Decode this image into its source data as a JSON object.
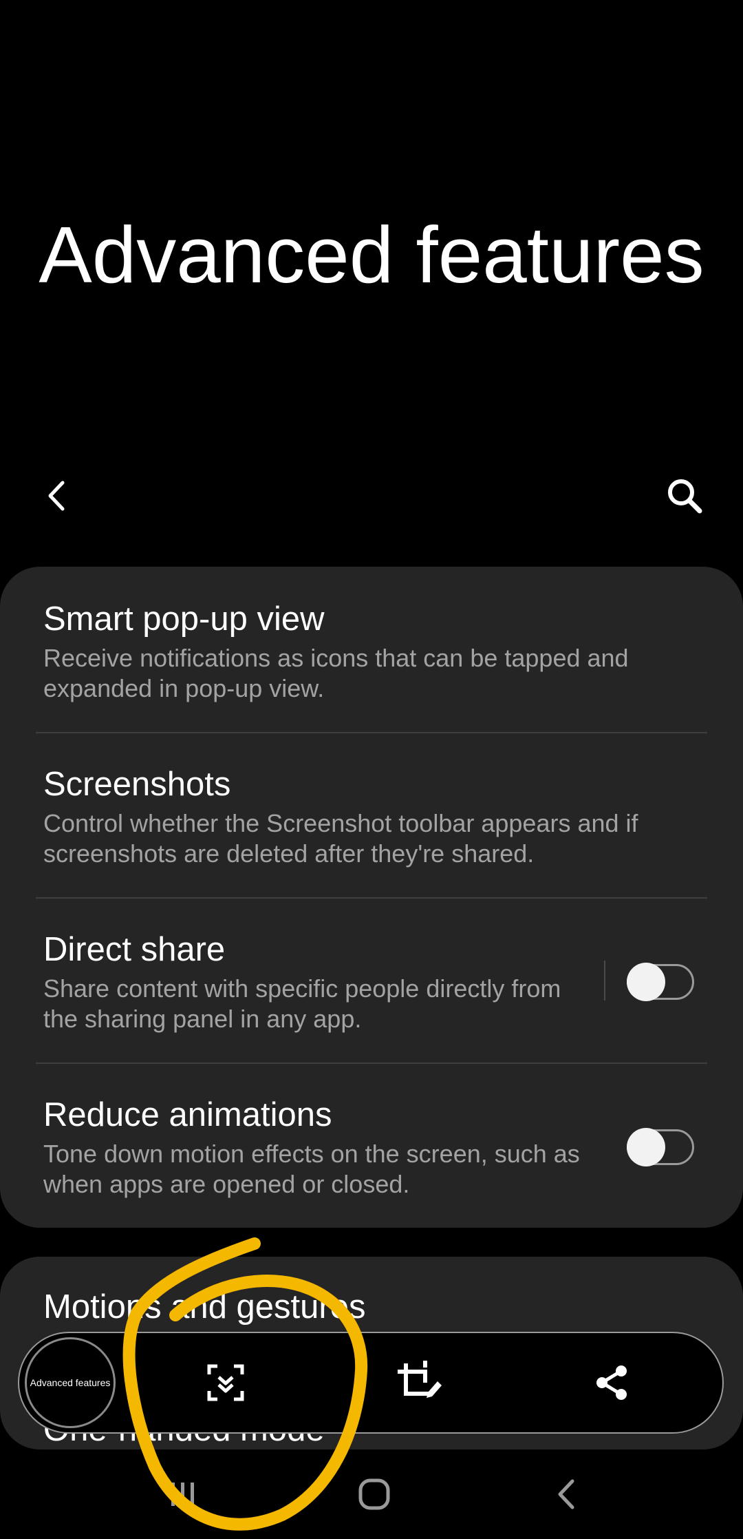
{
  "header": {
    "title": "Advanced features"
  },
  "settings": {
    "items": [
      {
        "title": "Smart pop-up view",
        "description": "Receive notifications as icons that can be tapped and expanded in pop-up view."
      },
      {
        "title": "Screenshots",
        "description": "Control whether the Screenshot toolbar appears and if screenshots are deleted after they're shared."
      },
      {
        "title": "Direct share",
        "description": "Share content with specific people directly from the sharing panel in any app.",
        "toggle_on": false
      },
      {
        "title": "Reduce animations",
        "description": "Tone down motion effects on the screen, such as when apps are opened or closed.",
        "toggle_on": false
      }
    ],
    "second_card": [
      {
        "title": "Motions and gestures"
      },
      {
        "title": "One-handed mode"
      }
    ]
  },
  "screenshot_toolbar": {
    "thumbnail_text": "Advanced features",
    "icons": [
      "scroll-capture-icon",
      "crop-edit-icon",
      "share-icon"
    ]
  },
  "colors": {
    "background": "#000000",
    "card": "#252525",
    "description_text": "#a3a3a3",
    "annotation": "#f5b800"
  }
}
